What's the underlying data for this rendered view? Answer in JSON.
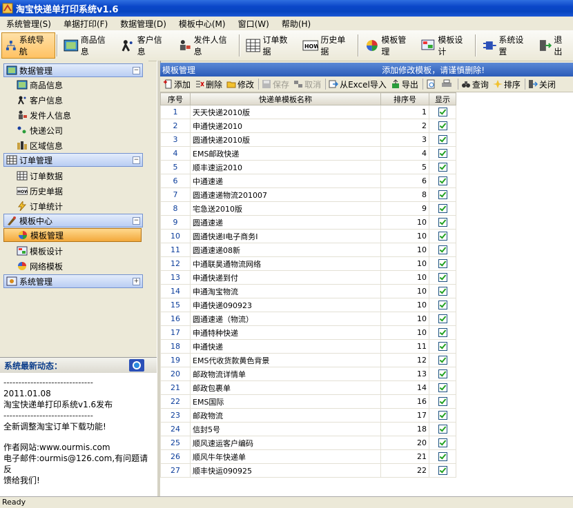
{
  "app": {
    "title": "淘宝快递单打印系统v1.6"
  },
  "menu": [
    "系统管理(S)",
    "单据打印(F)",
    "数据管理(D)",
    "模板中心(M)",
    "窗口(W)",
    "帮助(H)"
  ],
  "toolbar": {
    "nav": "系统导航",
    "goods": "商品信息",
    "customers": "客户信息",
    "senders": "发件人信息",
    "orders": "订单数据",
    "history": "历史单据",
    "templates": "模板管理",
    "design": "模板设计",
    "settings": "系统设置",
    "exit": "退出"
  },
  "sidebar": {
    "data_group": "数据管理",
    "data_items": [
      "商品信息",
      "客户信息",
      "发件人信息",
      "快递公司",
      "区域信息"
    ],
    "order_group": "订单管理",
    "order_items": [
      "订单数据",
      "历史单据",
      "订单统计"
    ],
    "template_group": "模板中心",
    "template_items": [
      "模板管理",
      "模板设计",
      "网络模板"
    ],
    "system_group": "系统管理"
  },
  "news": {
    "title": "系统最新动态：",
    "separator": "------------------------------",
    "date": "2011.01.08",
    "release": "淘宝快递单打印系统v1.6发布",
    "feature": "全新调整淘宝订单下载功能!",
    "site": "作者网站:www.ourmis.com",
    "email1": "电子邮件:ourmis@126.com,有问题请反",
    "email2": "馈给我们!"
  },
  "panel": {
    "title": "模板管理",
    "hint": "添加修改模板，请谨慎删除!",
    "buttons": {
      "add": "添加",
      "delete": "删除",
      "edit": "修改",
      "save": "保存",
      "cancel": "取消",
      "import": "从Excel导入",
      "export": "导出",
      "query": "查询",
      "sort": "排序",
      "close": "关闭"
    },
    "columns": [
      "序号",
      "快递单模板名称",
      "排序号",
      "显示"
    ]
  },
  "rows": [
    {
      "no": "1",
      "name": "天天快递2010版",
      "order": "1",
      "show": true
    },
    {
      "no": "2",
      "name": "申通快递2010",
      "order": "2",
      "show": true
    },
    {
      "no": "3",
      "name": "圆通快递2010版",
      "order": "3",
      "show": true
    },
    {
      "no": "4",
      "name": "EMS邮政快递",
      "order": "4",
      "show": true
    },
    {
      "no": "5",
      "name": "顺丰速运2010",
      "order": "5",
      "show": true
    },
    {
      "no": "6",
      "name": "中通速递",
      "order": "6",
      "show": true
    },
    {
      "no": "7",
      "name": "圆通速递物流201007",
      "order": "8",
      "show": true
    },
    {
      "no": "8",
      "name": "宅急送2010版",
      "order": "9",
      "show": true
    },
    {
      "no": "9",
      "name": "圆通速递",
      "order": "10",
      "show": true
    },
    {
      "no": "10",
      "name": "圆通快递I电子商务I",
      "order": "10",
      "show": true
    },
    {
      "no": "11",
      "name": "圆通速递08新",
      "order": "10",
      "show": true
    },
    {
      "no": "12",
      "name": "中通联昊通物流网络",
      "order": "10",
      "show": true
    },
    {
      "no": "13",
      "name": "申通快递到付",
      "order": "10",
      "show": true
    },
    {
      "no": "14",
      "name": "申通淘宝物流",
      "order": "10",
      "show": true
    },
    {
      "no": "15",
      "name": "申通快递090923",
      "order": "10",
      "show": true
    },
    {
      "no": "16",
      "name": "圆通速递（物流）",
      "order": "10",
      "show": true
    },
    {
      "no": "17",
      "name": "申通特种快递",
      "order": "10",
      "show": true
    },
    {
      "no": "18",
      "name": "申通快递",
      "order": "11",
      "show": true
    },
    {
      "no": "19",
      "name": "EMS代收货款黄色背景",
      "order": "12",
      "show": true
    },
    {
      "no": "20",
      "name": "邮政物流详情单",
      "order": "13",
      "show": true
    },
    {
      "no": "21",
      "name": "邮政包裹单",
      "order": "14",
      "show": true
    },
    {
      "no": "22",
      "name": "EMS国际",
      "order": "16",
      "show": true
    },
    {
      "no": "23",
      "name": "邮政物流",
      "order": "17",
      "show": true
    },
    {
      "no": "24",
      "name": "信封5号",
      "order": "18",
      "show": true
    },
    {
      "no": "25",
      "name": "顺风速运客户编码",
      "order": "20",
      "show": true
    },
    {
      "no": "26",
      "name": "顺风牛年快递单",
      "order": "21",
      "show": true
    },
    {
      "no": "27",
      "name": "顺丰快运090925",
      "order": "22",
      "show": true
    }
  ],
  "status": "Ready"
}
